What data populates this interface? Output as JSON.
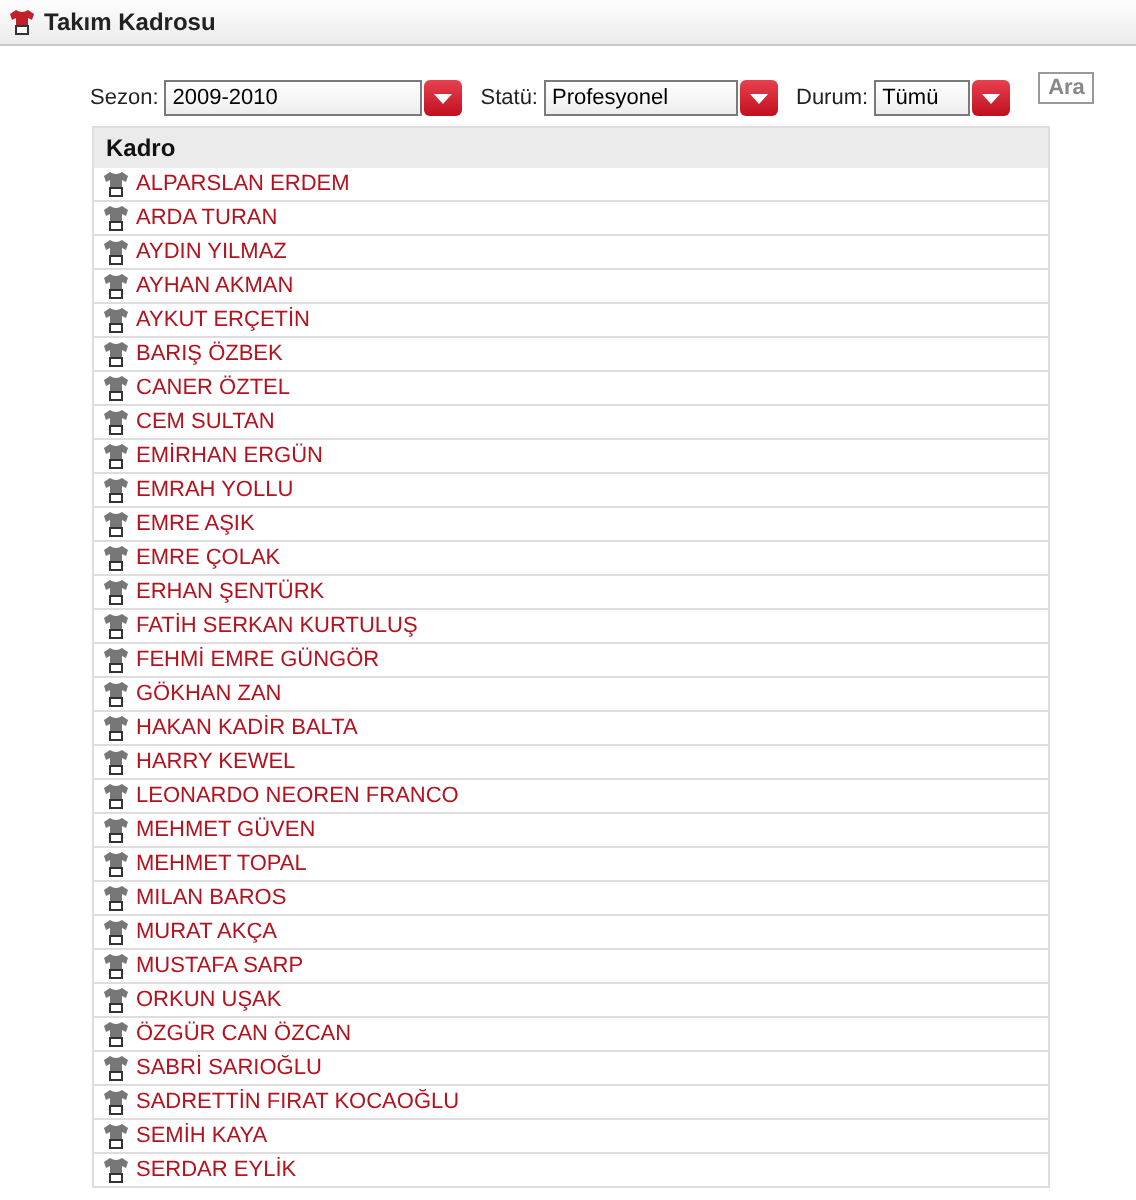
{
  "title": "Takım Kadrosu",
  "filters": [
    {
      "label": "Sezon:",
      "value": "2009-2010",
      "kind": "wide"
    },
    {
      "label": "Statü:",
      "value": "Profesyonel",
      "kind": "medium"
    },
    {
      "label": "Durum:",
      "value": "Tümü",
      "kind": "narrow"
    }
  ],
  "search_button": "Ara",
  "table": {
    "heading": "Kadro",
    "rows": [
      "ALPARSLAN ERDEM",
      "ARDA TURAN",
      "AYDIN YILMAZ",
      "AYHAN AKMAN",
      "AYKUT ERÇETİN",
      "BARIŞ ÖZBEK",
      "CANER ÖZTEL",
      "CEM SULTAN",
      "EMİRHAN ERGÜN",
      "EMRAH YOLLU",
      "EMRE AŞIK",
      "EMRE ÇOLAK",
      "ERHAN ŞENTÜRK",
      "FATİH SERKAN KURTULUŞ",
      "FEHMİ EMRE GÜNGÖR",
      "GÖKHAN ZAN",
      "HAKAN KADİR BALTA",
      "HARRY KEWEL",
      "LEONARDO NEOREN FRANCO",
      "MEHMET GÜVEN",
      "MEHMET TOPAL",
      "MILAN BAROS",
      "MURAT AKÇA",
      "MUSTAFA SARP",
      "ORKUN UŞAK",
      "ÖZGÜR CAN ÖZCAN",
      "SABRİ SARIOĞLU",
      "SADRETTİN FIRAT KOCAOĞLU",
      "SEMİH KAYA",
      "SERDAR EYLİK"
    ]
  }
}
